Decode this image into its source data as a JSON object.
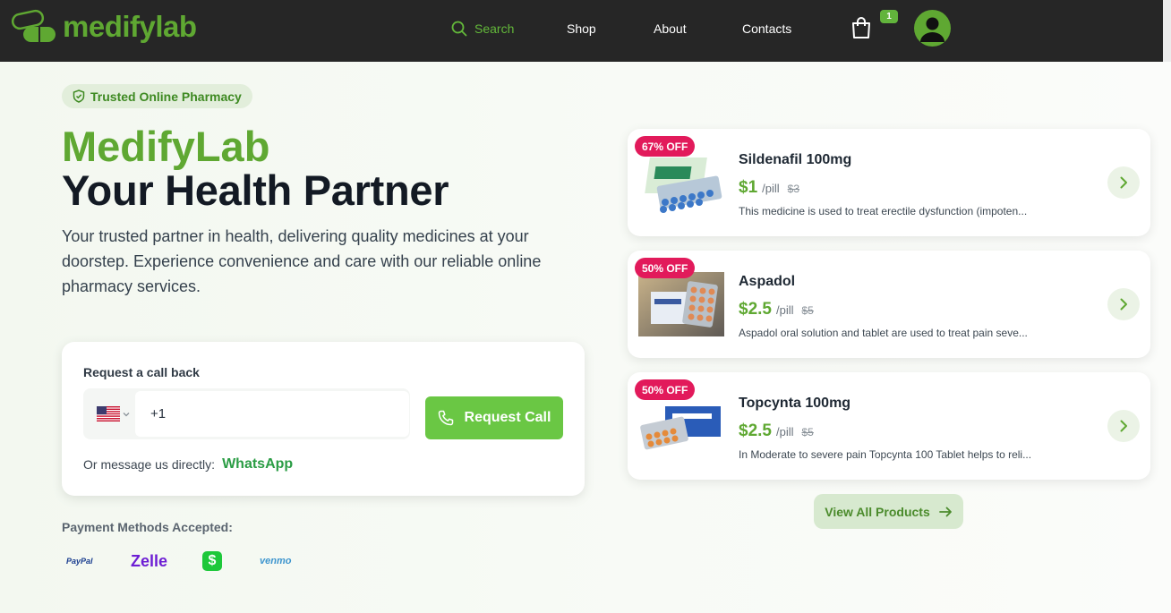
{
  "header": {
    "brand": "medifylab",
    "nav": {
      "search": "Search",
      "shop": "Shop",
      "about": "About",
      "contacts": "Contacts"
    },
    "cart_count": "1",
    "icons": [
      "pill-logo-icon",
      "search-icon",
      "cart-icon",
      "user-avatar-icon"
    ]
  },
  "hero": {
    "badge": "Trusted Online Pharmacy",
    "brand": "MedifyLab",
    "title": "Your Health Partner",
    "description": "Your trusted partner in health, delivering quality medicines at your doorstep. Experience convenience and care with our reliable online pharmacy services."
  },
  "callback": {
    "label": "Request a call back",
    "country_code": "+1",
    "button": "Request Call",
    "message_prefix": "Or message us directly:",
    "whatsapp": "WhatsApp"
  },
  "payments": {
    "label": "Payment Methods Accepted:",
    "methods": {
      "paypal": "PayPal",
      "zelle": "Zelle",
      "cashapp": "$",
      "venmo": "venmo"
    }
  },
  "products": [
    {
      "discount": "67% OFF",
      "name": "Sildenafil 100mg",
      "price": "$1",
      "unit": "/pill",
      "old_price": "$3",
      "description": "This medicine is used to treat erectile dysfunction (impoten..."
    },
    {
      "discount": "50% OFF",
      "name": "Aspadol",
      "price": "$2.5",
      "unit": "/pill",
      "old_price": "$5",
      "description": "Aspadol oral solution and tablet are used to treat pain seve..."
    },
    {
      "discount": "50% OFF",
      "name": "Topcynta 100mg",
      "price": "$2.5",
      "unit": "/pill",
      "old_price": "$5",
      "description": "In Moderate to severe pain Topcynta 100 Tablet helps to reli..."
    }
  ],
  "view_all": "View All Products",
  "colors": {
    "brand_green": "#5fa832",
    "button_green": "#6ac744",
    "discount_pink": "#e21a5b",
    "header_bg": "#262626"
  }
}
